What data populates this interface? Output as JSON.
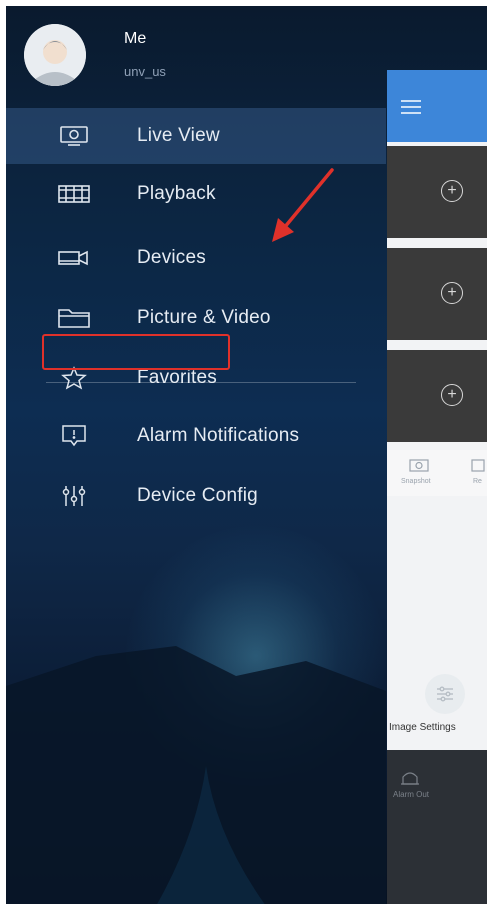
{
  "profile": {
    "name": "Me",
    "username": "unv_us",
    "avatar_icon": "user-avatar-icon"
  },
  "menu": {
    "items": [
      {
        "label": "Live View",
        "icon": "monitor-icon",
        "active": true
      },
      {
        "label": "Playback",
        "icon": "film-icon",
        "active": false
      },
      {
        "label": "Devices",
        "icon": "camera-icon",
        "active": false,
        "highlighted": true
      },
      {
        "label": "Picture & Video",
        "icon": "folder-icon",
        "active": false
      },
      {
        "label": "Favorites",
        "icon": "star-icon",
        "active": false
      },
      {
        "label": "Alarm Notifications",
        "icon": "alarm-message-icon",
        "active": false
      },
      {
        "label": "Device Config",
        "icon": "sliders-icon",
        "active": false
      }
    ]
  },
  "panel": {
    "menu_icon": "hamburger-icon",
    "slots": [
      "add-channel",
      "add-channel",
      "add-channel"
    ],
    "toolbar": {
      "snapshot_label": "Snapshot",
      "record_label": "Re"
    },
    "image_settings_label": "Image Settings",
    "alarm_out_label": "Alarm Out"
  },
  "colors": {
    "accent_blue": "#3d86d9",
    "highlight_red": "#e0312a",
    "drawer_bg": "#0c2541"
  }
}
